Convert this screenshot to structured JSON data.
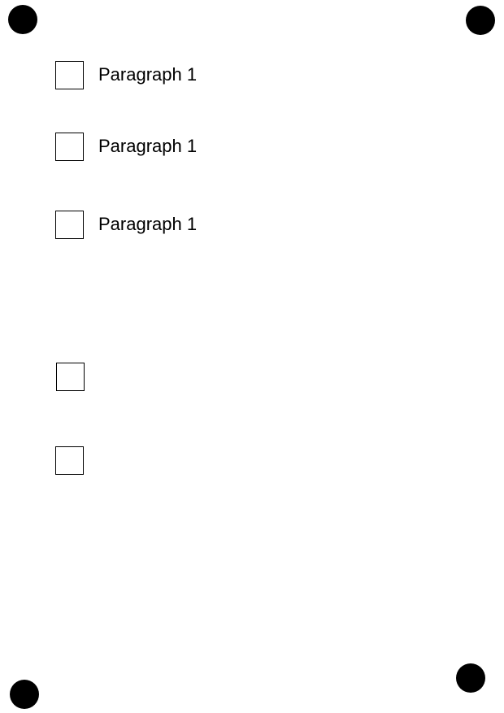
{
  "items": [
    {
      "label": "Paragraph 1",
      "checked": false
    },
    {
      "label": "Paragraph 1",
      "checked": false
    },
    {
      "label": "Paragraph 1",
      "checked": false
    },
    {
      "label": "",
      "checked": false
    },
    {
      "label": "",
      "checked": false
    }
  ],
  "colors": {
    "marker": "#000000",
    "border": "#000000",
    "background": "#ffffff"
  }
}
